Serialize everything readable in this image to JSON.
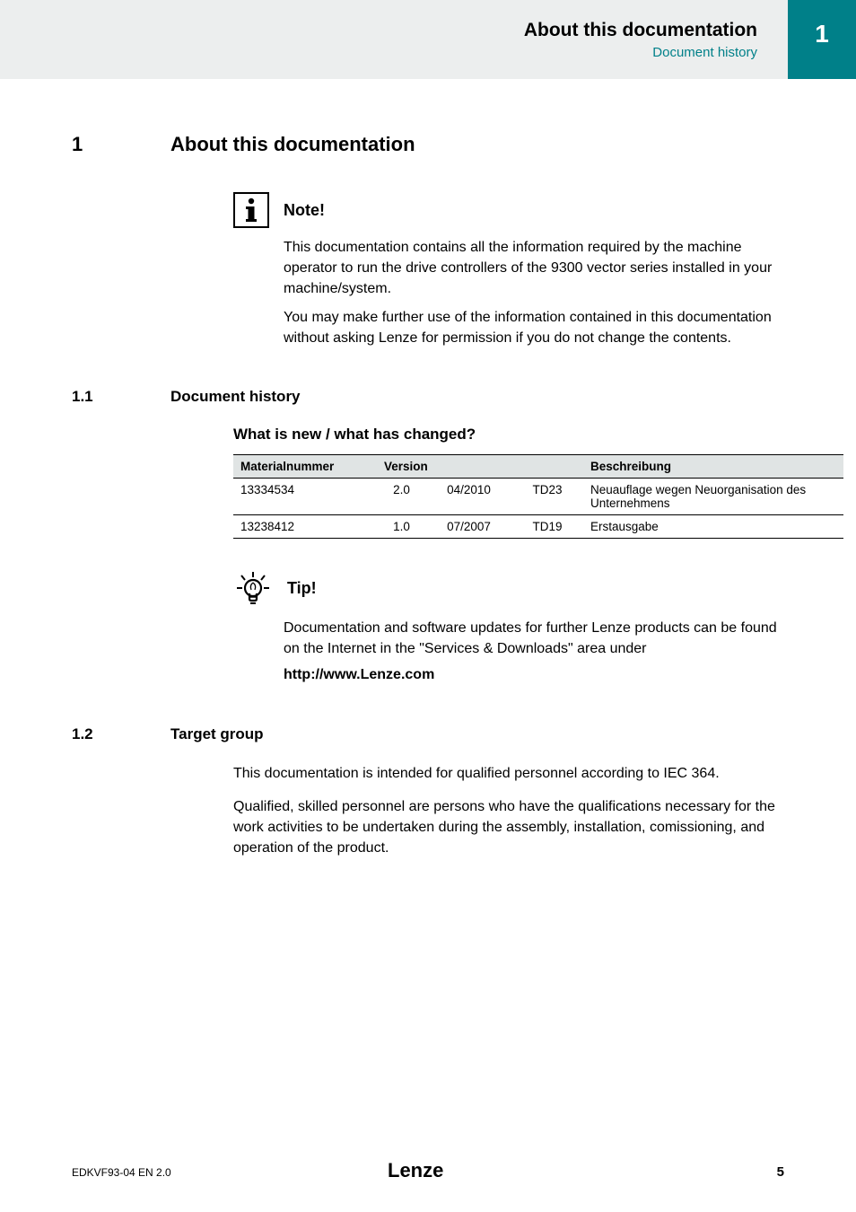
{
  "header": {
    "title": "About this documentation",
    "subtitle": "Document history",
    "page_tab": "1"
  },
  "chapter": {
    "num": "1",
    "title": "About this documentation"
  },
  "note": {
    "label": "Note!",
    "para1": "This documentation contains all the information required by the machine operator to run the drive controllers of the 9300 vector series installed in your machine/system.",
    "para2": "You may make further use of the information contained in this documentation without asking Lenze for permission if you do not change the contents."
  },
  "section_1_1": {
    "num": "1.1",
    "title": "Document history",
    "sub_heading": "What is new / what has changed?"
  },
  "table": {
    "headers": {
      "col1": "Materialnummer",
      "col2": "Version",
      "col5": "Beschreibung"
    },
    "rows": [
      {
        "material": "13334534",
        "v1": "2.0",
        "v2": "04/2010",
        "v3": "TD23",
        "desc": "Neuauflage wegen Neuorganisation des Unternehmens"
      },
      {
        "material": "13238412",
        "v1": "1.0",
        "v2": "07/2007",
        "v3": "TD19",
        "desc": "Erstausgabe"
      }
    ]
  },
  "tip": {
    "label": "Tip!",
    "para": "Documentation and software updates for further Lenze products can be found on the Internet in the \"Services & Downloads\" area under",
    "link": "http://www.Lenze.com"
  },
  "section_1_2": {
    "num": "1.2",
    "title": "Target group",
    "para1": "This documentation is intended for qualified personnel according to IEC 364.",
    "para2": "Qualified, skilled personnel are persons who have the qualifications necessary for the work activities to be undertaken during the assembly, installation, comissioning, and operation of the product."
  },
  "footer": {
    "left": "EDKVF93-04  EN  2.0",
    "right": "5"
  }
}
